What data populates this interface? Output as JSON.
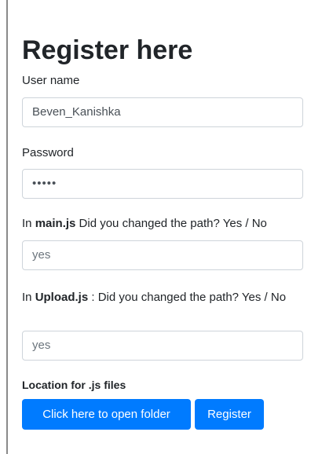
{
  "form": {
    "title": "Register here",
    "username_label": "User name",
    "username_value": "Beven_Kanishka",
    "password_label": "Password",
    "password_mask": "•••••",
    "mainjs_label_prefix": "In ",
    "mainjs_label_bold": "main.js",
    "mainjs_label_suffix": " Did you changed the path? Yes / No",
    "mainjs_value": "yes",
    "uploadjs_label_prefix": "In ",
    "uploadjs_label_bold": "Upload.js",
    "uploadjs_label_suffix": " : Did you changed the path? Yes / No",
    "uploadjs_value": "yes",
    "location_label": "Location for .js files",
    "open_folder_button": "Click here to open folder",
    "register_button": "Register"
  },
  "colors": {
    "primary": "#007bff",
    "border": "#ced4da"
  }
}
